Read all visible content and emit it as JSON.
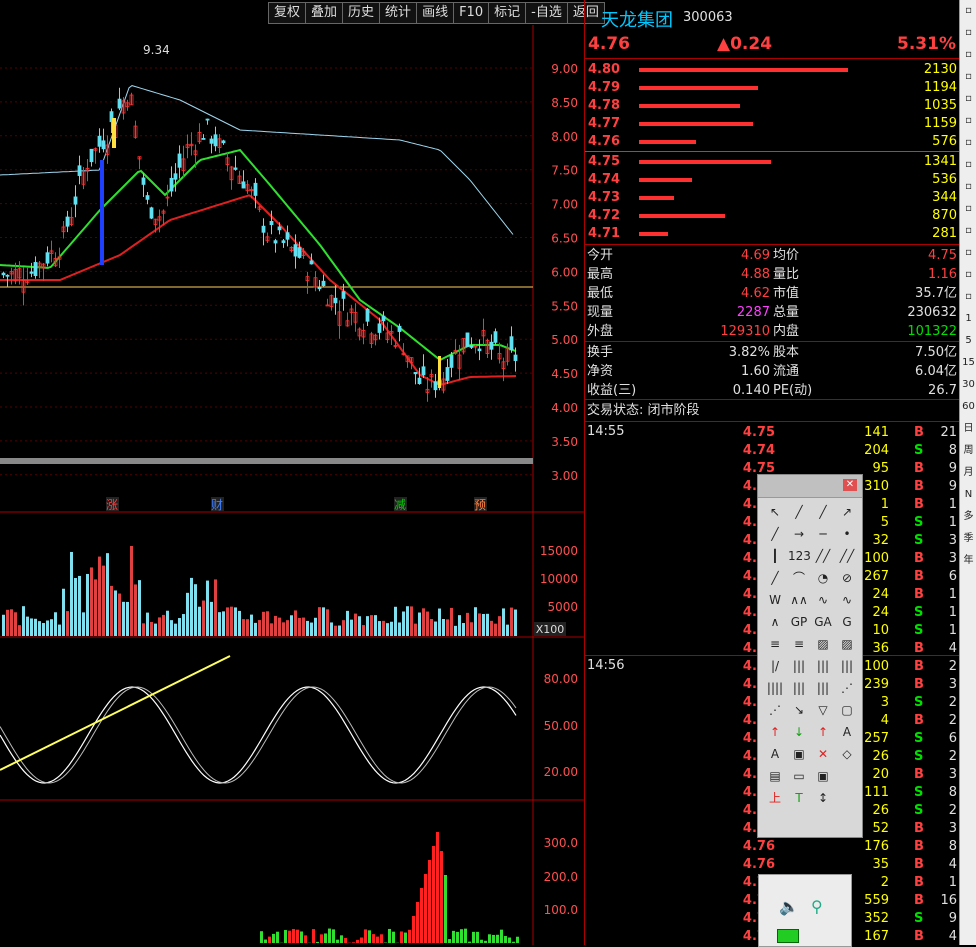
{
  "toolbar": [
    "复权",
    "叠加",
    "历史",
    "统计",
    "画线",
    "F10",
    "标记",
    "-自选",
    "返回"
  ],
  "header": {
    "name": "天龙集团",
    "code": "300063",
    "price": "4.76",
    "change": "▲0.24",
    "pct": "5.31%"
  },
  "price_axis": [
    "9.00",
    "8.50",
    "8.00",
    "7.50",
    "7.00",
    "6.50",
    "6.00",
    "5.50",
    "5.00",
    "4.50",
    "4.00",
    "3.50",
    "3.00"
  ],
  "high_label": "9.34",
  "events": [
    "涨",
    "财",
    "减",
    "预"
  ],
  "vol_axis": [
    "15000",
    "10000",
    "5000"
  ],
  "vol_unit": "X100",
  "kd_axis": [
    "80.00",
    "50.00",
    "20.00"
  ],
  "macd_axis": [
    "300.0",
    "200.0",
    "100.0"
  ],
  "asks": [
    {
      "p": "4.80",
      "v": "2130",
      "w": 0.95
    },
    {
      "p": "4.79",
      "v": "1194",
      "w": 0.54
    },
    {
      "p": "4.78",
      "v": "1035",
      "w": 0.46
    },
    {
      "p": "4.77",
      "v": "1159",
      "w": 0.52
    },
    {
      "p": "4.76",
      "v": "576",
      "w": 0.26
    }
  ],
  "bids": [
    {
      "p": "4.75",
      "v": "1341",
      "w": 0.6
    },
    {
      "p": "4.74",
      "v": "536",
      "w": 0.24
    },
    {
      "p": "4.73",
      "v": "344",
      "w": 0.16
    },
    {
      "p": "4.72",
      "v": "870",
      "w": 0.39
    },
    {
      "p": "4.71",
      "v": "281",
      "w": 0.13
    }
  ],
  "stats": [
    [
      "今开",
      "4.69",
      "均价",
      "4.75"
    ],
    [
      "最高",
      "4.88",
      "量比",
      "1.16"
    ],
    [
      "最低",
      "4.62",
      "市值",
      "35.7亿"
    ],
    [
      "现量",
      "2287",
      "总量",
      "230632"
    ],
    [
      "外盘",
      "129310",
      "内盘",
      "101322"
    ]
  ],
  "stats2": [
    [
      "换手",
      "3.82%",
      "股本",
      "7.50亿"
    ],
    [
      "净资",
      "1.60",
      "流通",
      "6.04亿"
    ],
    [
      "收益(三)",
      "0.140",
      "PE(动)",
      "26.7"
    ]
  ],
  "status": "交易状态: 闭市阶段",
  "ticks1_time": "14:55",
  "ticks2_time": "14:56",
  "ticks": [
    [
      "4.75",
      "141",
      "B",
      "21"
    ],
    [
      "4.74",
      "204",
      "S",
      "8"
    ],
    [
      "4.75",
      "95",
      "B",
      "9"
    ],
    [
      "4.74",
      "310",
      "B",
      "9"
    ],
    [
      "4.75",
      "1",
      "B",
      "1"
    ],
    [
      "4.74",
      "5",
      "S",
      "1"
    ],
    [
      "4.75",
      "32",
      "S",
      "3"
    ],
    [
      "4.75",
      "100",
      "B",
      "3"
    ],
    [
      "4.74",
      "267",
      "B",
      "6"
    ],
    [
      "4.75",
      "24",
      "B",
      "1"
    ],
    [
      "4.74",
      "24",
      "S",
      "1"
    ],
    [
      "4.75",
      "10",
      "S",
      "1"
    ],
    [
      "4.75",
      "36",
      "B",
      "4"
    ],
    [
      "4.74",
      "100",
      "B",
      "2"
    ],
    [
      "4.75",
      "239",
      "B",
      "3"
    ],
    [
      "4.75",
      "3",
      "S",
      "2"
    ],
    [
      "4.76",
      "4",
      "B",
      "2"
    ],
    [
      "4.75",
      "257",
      "S",
      "6"
    ],
    [
      "4.75",
      "26",
      "S",
      "2"
    ],
    [
      "4.74",
      "20",
      "B",
      "3"
    ],
    [
      "4.76",
      "111",
      "S",
      "8"
    ],
    [
      "4.75",
      "26",
      "S",
      "2"
    ],
    [
      "4.76",
      "52",
      "B",
      "3"
    ],
    [
      "4.76",
      "176",
      "B",
      "8"
    ],
    [
      "4.76",
      "35",
      "B",
      "4"
    ],
    [
      "4.75",
      "2",
      "B",
      "1"
    ],
    [
      "4.76",
      "559",
      "B",
      "16"
    ],
    [
      "4.76",
      "352",
      "S",
      "9"
    ],
    [
      "4.75",
      "167",
      "B",
      "4"
    ]
  ],
  "sidebar": [
    "1",
    "5",
    "15",
    "30",
    "60",
    "日",
    "周",
    "月",
    "N",
    "多",
    "季",
    "年"
  ]
}
